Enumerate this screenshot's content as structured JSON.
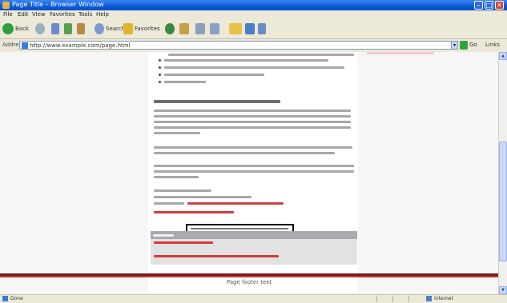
{
  "window": {
    "title": "Page Title – Browser Window",
    "min": "–",
    "max": "□",
    "close": "✕"
  },
  "menu": [
    "File",
    "Edit",
    "View",
    "Favorites",
    "Tools",
    "Help"
  ],
  "toolbar": {
    "back": "Back",
    "search": "Search",
    "favorites": "Favorites"
  },
  "address": {
    "label": "Address",
    "value": "http://www.example.com/page.html",
    "go": "Go",
    "links": "Links",
    "drop": "▾"
  },
  "page": {
    "footer": "Page footer text"
  },
  "status": {
    "text": "Done",
    "zone": "Internet"
  },
  "scroll": {
    "up": "▲",
    "down": "▼"
  },
  "icons": [
    "app-icon",
    "back-icon",
    "forward-icon",
    "stop-icon",
    "refresh-icon",
    "home-icon",
    "search-icon",
    "favorites-icon",
    "history-icon",
    "mail-icon",
    "print-icon",
    "edit-icon",
    "folder-icon",
    "go-icon",
    "page-icon"
  ]
}
